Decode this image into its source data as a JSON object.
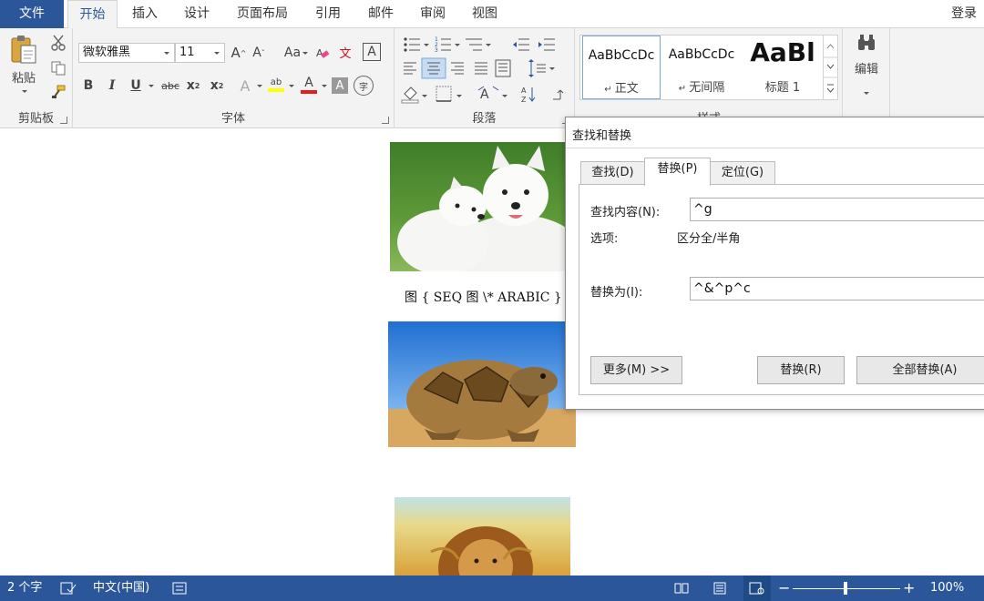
{
  "tabs": {
    "file": "文件",
    "home": "开始",
    "insert": "插入",
    "design": "设计",
    "layout": "页面布局",
    "references": "引用",
    "mailings": "邮件",
    "review": "审阅",
    "view": "视图",
    "login": "登录"
  },
  "ribbon": {
    "clipboard": {
      "label": "剪贴板",
      "paste": "粘贴"
    },
    "font": {
      "label": "字体",
      "name": "微软雅黑",
      "size": "11",
      "grow": "A",
      "shrink": "A",
      "change_case": "Aa",
      "phonetic": "文",
      "border_char": "A",
      "bold": "B",
      "italic": "I",
      "underline": "U",
      "strike": "abc",
      "subscript": "x",
      "superscript": "x",
      "sub_mark": "2",
      "sup_mark": "2",
      "highlight": "ab",
      "font_color": "A",
      "shading": "A",
      "enclose": "字"
    },
    "paragraph": {
      "label": "段落"
    },
    "styles": {
      "label": "样式",
      "items": [
        {
          "sample": "AaBbCcDc",
          "name": "正文"
        },
        {
          "sample": "AaBbCcDc",
          "name": "无间隔"
        },
        {
          "sample": "AaBl",
          "name": "标题 1"
        }
      ]
    },
    "editing": {
      "label": "编辑"
    }
  },
  "document": {
    "caption": "图 { SEQ 图 \\* ARABIC }"
  },
  "dialog": {
    "title": "查找和替换",
    "tabs": [
      "查找(D)",
      "替换(P)",
      "定位(G)"
    ],
    "find_label": "查找内容(N):",
    "find_value": "^g",
    "options_label": "选项:",
    "options_value": "区分全/半角",
    "replace_label": "替换为(I):",
    "replace_value": "^&^p^c",
    "more_button": "更多(M) >>",
    "replace_button": "替换(R)",
    "replace_all_button": "全部替换(A)"
  },
  "status": {
    "word_count": "2 个字",
    "language": "中文(中国)",
    "zoom": "100%"
  },
  "colors": {
    "accent": "#2b579a",
    "arrow": "#e8312a",
    "highlight": "#ffff00",
    "font_color": "#e02020"
  }
}
